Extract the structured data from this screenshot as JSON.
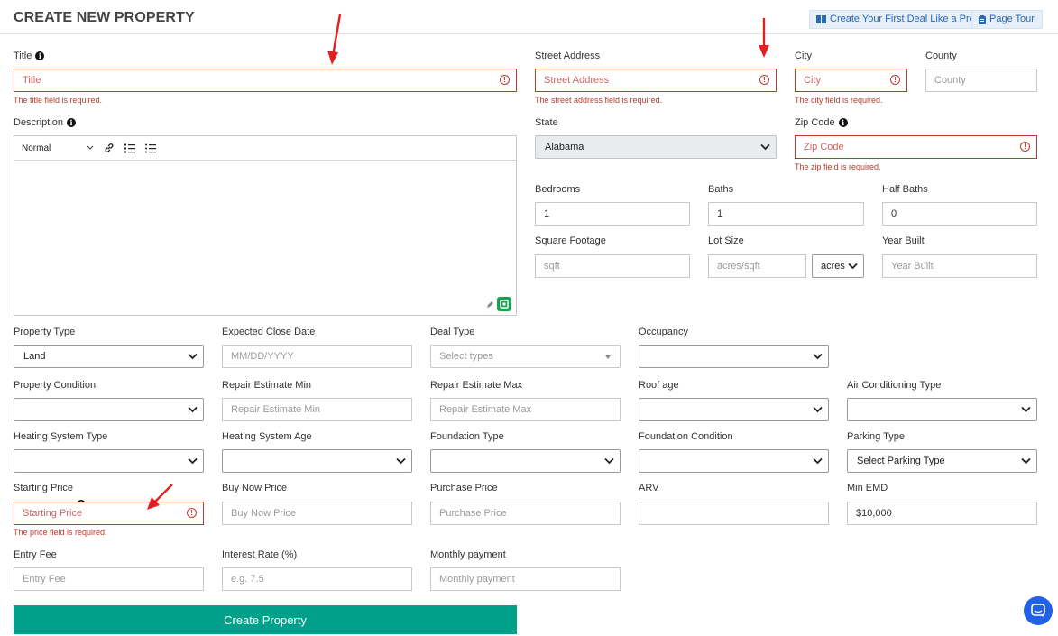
{
  "header": {
    "title": "CREATE NEW PROPERTY",
    "deal_button": "Create Your First Deal Like a Pro",
    "tour_button": "Page Tour"
  },
  "form": {
    "title": {
      "label": "Title",
      "placeholder": "Title",
      "error": "The title field is required."
    },
    "street": {
      "label": "Street Address",
      "placeholder": "Street Address",
      "error": "The street address field is required."
    },
    "city": {
      "label": "City",
      "placeholder": "City",
      "error": "The city field is required."
    },
    "county": {
      "label": "County",
      "placeholder": "County"
    },
    "description": {
      "label": "Description",
      "format": "Normal"
    },
    "state": {
      "label": "State",
      "value": "Alabama"
    },
    "zip": {
      "label": "Zip Code",
      "placeholder": "Zip Code",
      "error": "The zip field is required."
    },
    "bedrooms": {
      "label": "Bedrooms",
      "value": "1"
    },
    "baths": {
      "label": "Baths",
      "value": "1"
    },
    "half_baths": {
      "label": "Half Baths",
      "value": "0"
    },
    "sqft": {
      "label": "Square Footage",
      "placeholder": "sqft"
    },
    "lot_size": {
      "label": "Lot Size",
      "placeholder": "acres/sqft",
      "unit": "acres"
    },
    "year_built": {
      "label": "Year Built",
      "placeholder": "Year Built"
    },
    "property_type": {
      "label": "Property Type",
      "value": "Land"
    },
    "close_date": {
      "label": "Expected Close Date",
      "placeholder": "MM/DD/YYYY"
    },
    "deal_type": {
      "label": "Deal Type",
      "placeholder": "Select types"
    },
    "occupancy": {
      "label": "Occupancy",
      "value": ""
    },
    "condition": {
      "label": "Property Condition",
      "value": ""
    },
    "repair_min": {
      "label": "Repair Estimate Min",
      "placeholder": "Repair Estimate Min"
    },
    "repair_max": {
      "label": "Repair Estimate Max",
      "placeholder": "Repair Estimate Max"
    },
    "roof_age": {
      "label": "Roof age",
      "value": ""
    },
    "ac_type": {
      "label": "Air Conditioning Type",
      "value": ""
    },
    "heating_type": {
      "label": "Heating System Type",
      "value": ""
    },
    "heating_age": {
      "label": "Heating System Age",
      "value": ""
    },
    "foundation_type": {
      "label": "Foundation Type",
      "value": ""
    },
    "foundation_condition": {
      "label": "Foundation Condition",
      "value": ""
    },
    "parking": {
      "label": "Parking Type",
      "value": "Select Parking Type"
    },
    "starting_price": {
      "label": "Starting Price",
      "placeholder": "Starting Price",
      "error": "The price field is required."
    },
    "buy_now": {
      "label": "Buy Now Price",
      "placeholder": "Buy Now Price"
    },
    "purchase_price": {
      "label": "Purchase Price",
      "placeholder": "Purchase Price"
    },
    "arv": {
      "label": "ARV",
      "placeholder": ""
    },
    "min_emd": {
      "label": "Min EMD",
      "value": "$10,000"
    },
    "entry_fee": {
      "label": "Entry Fee",
      "placeholder": "Entry Fee"
    },
    "interest_rate": {
      "label": "Interest Rate (%)",
      "placeholder": "e.g. 7.5"
    },
    "monthly_payment": {
      "label": "Monthly payment",
      "placeholder": "Monthly payment"
    },
    "submit": "Create Property"
  },
  "colors": {
    "accent": "#00a08a",
    "error": "#c0392b",
    "link": "#2a68b8",
    "chat": "#2160e8"
  }
}
